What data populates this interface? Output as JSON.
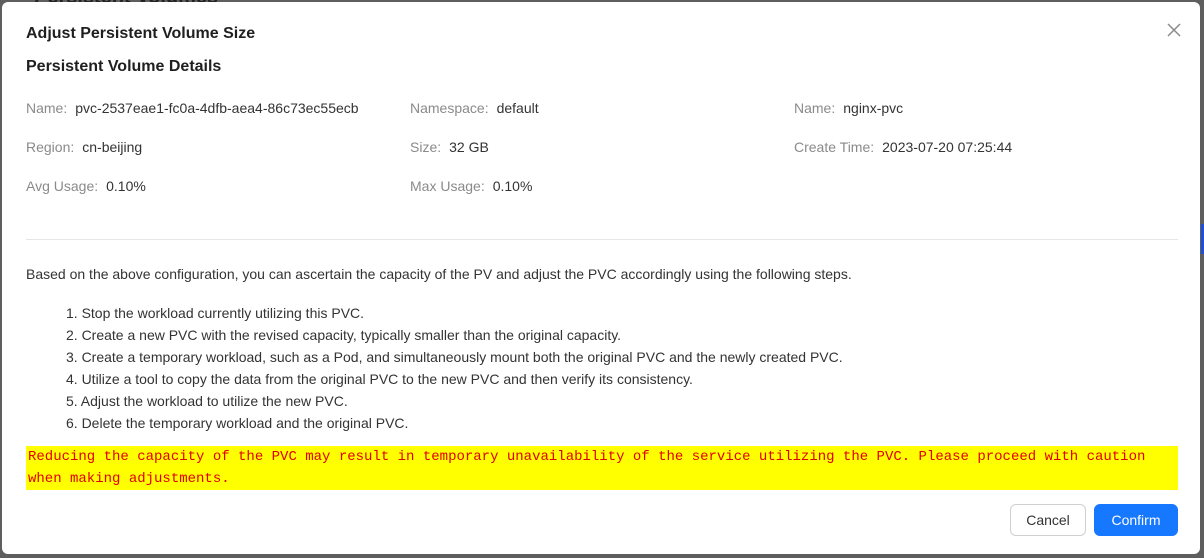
{
  "background": {
    "title": "Persistent Volumes"
  },
  "dialog": {
    "title": "Adjust Persistent Volume Size",
    "close_icon": "close-icon",
    "section_title": "Persistent Volume Details",
    "separator": ":",
    "details": {
      "name_label": "Name",
      "name_value": "pvc-2537eae1-fc0a-4dfb-aea4-86c73ec55ecb",
      "namespace_label": "Namespace",
      "namespace_value": "default",
      "name2_label": "Name",
      "name2_value": "nginx-pvc",
      "region_label": "Region",
      "region_value": "cn-beijing",
      "size_label": "Size",
      "size_value": "32 GB",
      "create_time_label": "Create Time",
      "create_time_value": "2023-07-20 07:25:44",
      "avg_usage_label": "Avg Usage",
      "avg_usage_value": "0.10%",
      "max_usage_label": "Max Usage",
      "max_usage_value": "0.10%"
    },
    "intro": "Based on the above configuration, you can ascertain the capacity of the PV and adjust the PVC accordingly using the following steps.",
    "steps": [
      "1. Stop the workload currently utilizing this PVC.",
      "2. Create a new PVC with the revised capacity, typically smaller than the original capacity.",
      "3. Create a temporary workload, such as a Pod, and simultaneously mount both the original PVC and the newly created PVC.",
      "4. Utilize a tool to copy the data from the original PVC to the new PVC and then verify its consistency.",
      "5. Adjust the workload to utilize the new PVC.",
      "6. Delete the temporary workload and the original PVC."
    ],
    "warning": "Reducing the capacity of the PVC may result in temporary unavailability of the service utilizing the PVC. Please proceed with caution when making adjustments.",
    "cancel_label": "Cancel",
    "confirm_label": "Confirm"
  },
  "colors": {
    "primary": "#1677ff",
    "warning_bg": "#ffff00",
    "warning_text": "#e00000"
  }
}
